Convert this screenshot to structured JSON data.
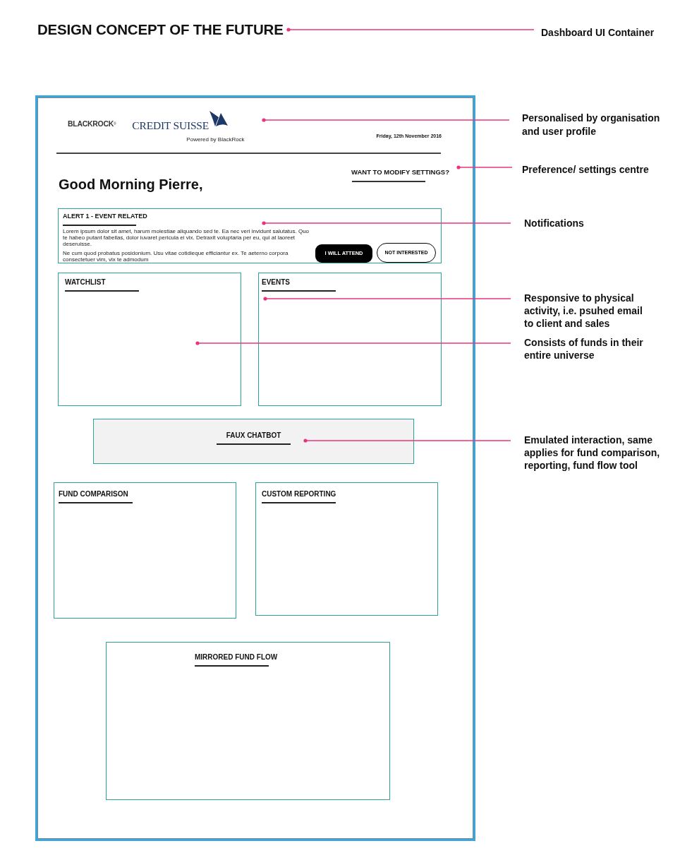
{
  "title": "DESIGN CONCEPT OF THE FUTURE",
  "dashboard": {
    "header": {
      "brand_logo": "BLACKROCK$^{®}$",
      "client_logo": "CREDIT SUISSE",
      "powered_by": "Powered by BlackRock",
      "date": "Friday, 12th November 2016"
    },
    "settings_link": "WANT TO MODIFY SETTINGS?",
    "greeting": "Good Morning Pierre,",
    "alert": {
      "title": "ALERT 1 - EVENT RELATED",
      "paragraphs": [
        "Lorem ipsum dolor sit amet, harum molestiae aliquando sed te. Ea nec veri invidunt salutatus. Quo te habeo putant fabellas, dolor iuvaret pericula ei vix. Detraxit voluptaria per eu, qui at laoreet deseruisse.",
        "Ne cum quod probatus posidonium. Usu vitae cotidieque efficiantur ex. Te aeterno corpora consectetuer vim, vix te admodum"
      ],
      "buttons": [
        {
          "label": "I WILL ATTEND",
          "kind": "primary"
        },
        {
          "label": "NOT INTERESTED",
          "kind": "secondary"
        }
      ]
    },
    "panels": [
      {
        "title": "WATCHLIST",
        "kind": "outline"
      },
      {
        "title": "EVENTS",
        "kind": "outline"
      },
      {
        "title": "FAUX CHATBOT",
        "kind": "shaded"
      },
      {
        "title": "FUND COMPARISON",
        "kind": "outline"
      },
      {
        "title": "CUSTOM REPORTING",
        "kind": "outline"
      },
      {
        "title": "MIRRORED FUND FLOW",
        "kind": "outline"
      }
    ]
  },
  "annotations": [
    {
      "lines": [
        "Dashboard UI Container"
      ]
    },
    {
      "lines": [
        "Personalised by organisation",
        "and user profile"
      ]
    },
    {
      "lines": [
        "Preference/ settings centre"
      ]
    },
    {
      "lines": [
        "Notifications"
      ]
    },
    {
      "lines": [
        "Responsive to physical",
        "activity, i.e. psuhed email",
        "to client and sales"
      ]
    },
    {
      "lines": [
        "Consists of funds in their",
        "entire universe"
      ]
    },
    {
      "lines": [
        "Emulated interaction, same",
        "applies for fund comparison,",
        "reporting, fund flow tool"
      ]
    }
  ]
}
